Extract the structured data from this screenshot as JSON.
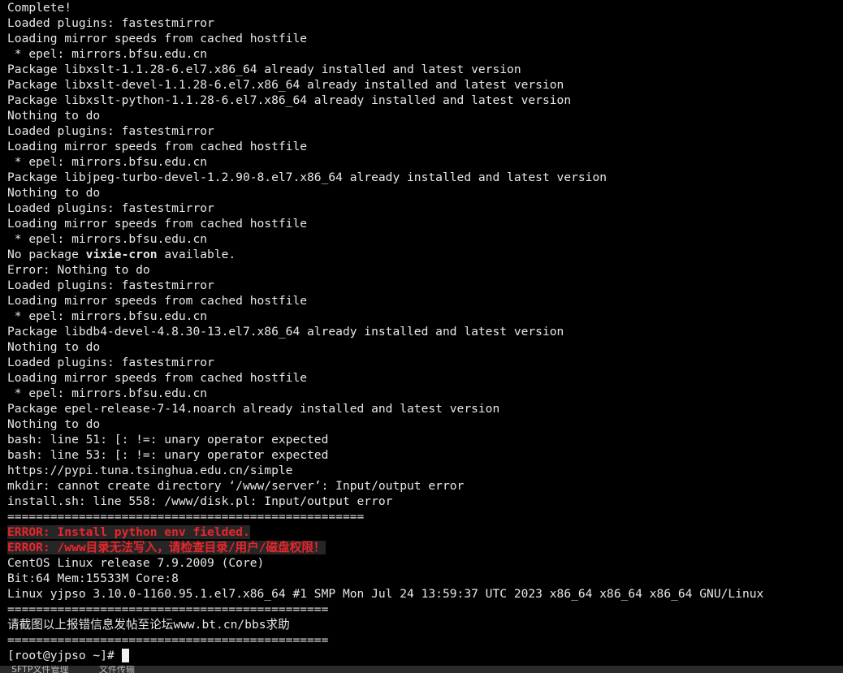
{
  "terminal": {
    "lines": [
      "Complete!",
      "Loaded plugins: fastestmirror",
      "Loading mirror speeds from cached hostfile",
      " * epel: mirrors.bfsu.edu.cn",
      "Package libxslt-1.1.28-6.el7.x86_64 already installed and latest version",
      "Package libxslt-devel-1.1.28-6.el7.x86_64 already installed and latest version",
      "Package libxslt-python-1.1.28-6.el7.x86_64 already installed and latest version",
      "Nothing to do",
      "Loaded plugins: fastestmirror",
      "Loading mirror speeds from cached hostfile",
      " * epel: mirrors.bfsu.edu.cn",
      "Package libjpeg-turbo-devel-1.2.90-8.el7.x86_64 already installed and latest version",
      "Nothing to do",
      "Loaded plugins: fastestmirror",
      "Loading mirror speeds from cached hostfile",
      " * epel: mirrors.bfsu.edu.cn",
      "No package ",
      "Error: Nothing to do",
      "Loaded plugins: fastestmirror",
      "Loading mirror speeds from cached hostfile",
      " * epel: mirrors.bfsu.edu.cn",
      "Package libdb4-devel-4.8.30-13.el7.x86_64 already installed and latest version",
      "Nothing to do",
      "Loaded plugins: fastestmirror",
      "Loading mirror speeds from cached hostfile",
      " * epel: mirrors.bfsu.edu.cn",
      "Package epel-release-7-14.noarch already installed and latest version",
      "Nothing to do",
      "bash: line 51: [: !=: unary operator expected",
      "bash: line 53: [: !=: unary operator expected",
      "https://pypi.tuna.tsinghua.edu.cn/simple",
      "mkdir: cannot create directory ‘/www/server’: Input/output error",
      "install.sh: line 558: /www/disk.pl: Input/output error",
      "==================================================",
      "ERROR: Install python env fielded.",
      "ERROR: /www目录无法写入，请检查目录/用户/磁盘权限！",
      "CentOS Linux release 7.9.2009 (Core)",
      "Bit:64 Mem:15533M Core:8",
      "Linux yjpso 3.10.0-1160.95.1.el7.x86_64 #1 SMP Mon Jul 24 13:59:37 UTC 2023 x86_64 x86_64 x86_64 GNU/Linux",
      "=============================================",
      "请截图以上报错信息发帖至论坛www.bt.cn/bbs求助",
      "=============================================",
      "[root@yjpso ~]# "
    ],
    "missing_package": {
      "name": "vixie-cron",
      "suffix": " available."
    }
  },
  "bottom_tabs": {
    "sftp": "SFTP文件管理",
    "transfer": "文件传输"
  },
  "colors": {
    "background": "#000000",
    "text": "#e8e8e8",
    "error": "#e8262d"
  }
}
